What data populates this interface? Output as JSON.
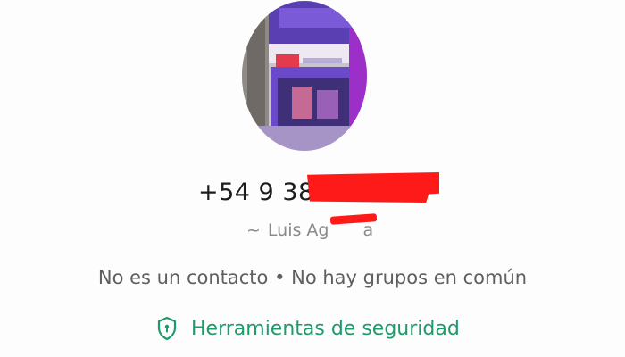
{
  "contact": {
    "phone_visible": "+54 9 381",
    "phone_redacted": true,
    "display_name_prefix": "~",
    "display_name_visible_start": "Luis Ag",
    "display_name_visible_end": "a",
    "name_redacted": true,
    "info_line": "No es un contacto • No hay grupos en común",
    "security_label": "Herramientas de seguridad"
  },
  "colors": {
    "background": "#fdfdfd",
    "phone_text": "#1c1c1c",
    "secondary_text": "#8a8a8a",
    "info_text": "#5f5f5f",
    "accent_green": "#1f9a6a",
    "redaction": "#ff1a1a"
  },
  "icons": {
    "security": "shield-lock-icon"
  }
}
